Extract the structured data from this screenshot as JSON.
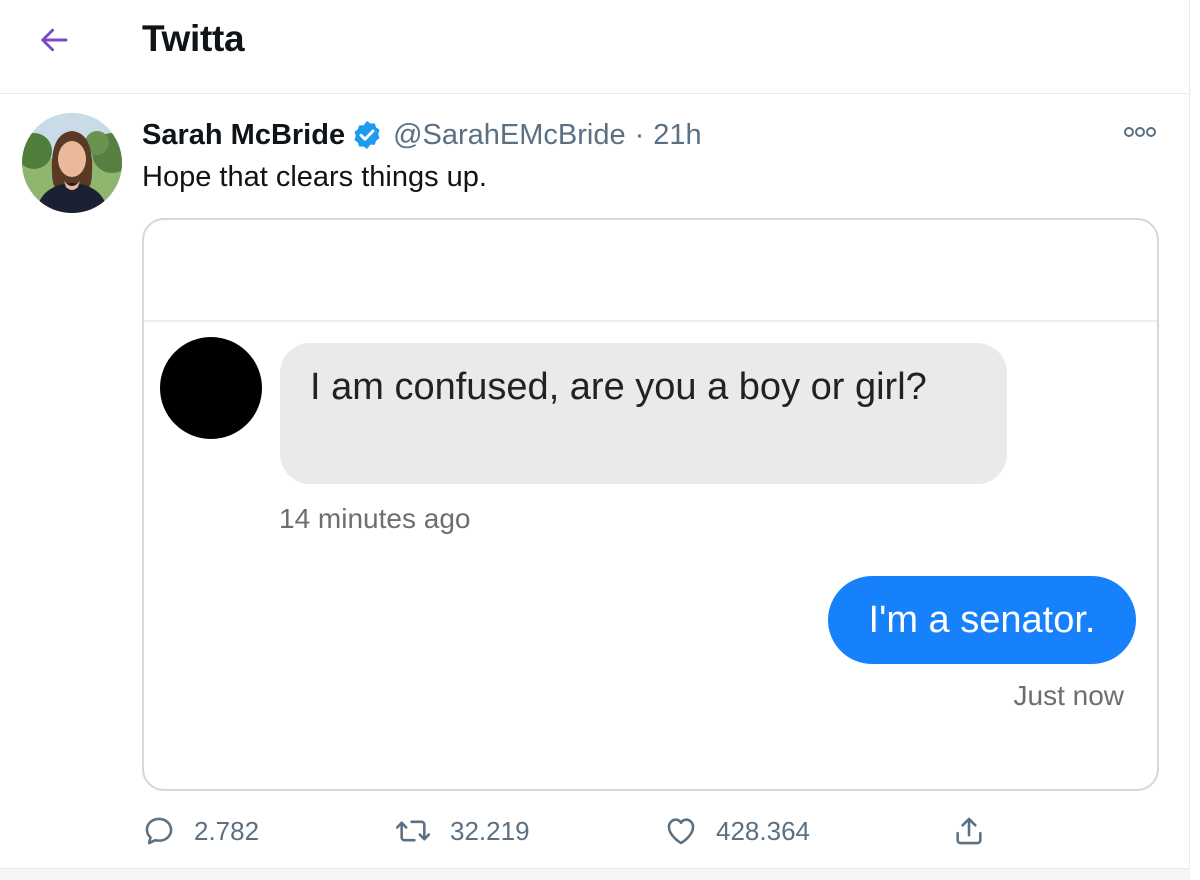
{
  "header": {
    "title": "Twitta",
    "back_icon": "arrow-left-icon",
    "accent_color": "#794bc4"
  },
  "tweet": {
    "author_name": "Sarah McBride",
    "verified_icon": "verified-badge-icon",
    "handle": "@SarahEMcBride",
    "separator": "·",
    "time": "21h",
    "more_icon": "more-horizontal-icon",
    "text": "Hope that clears things up.",
    "media": {
      "incoming_message": "I am confused, are you a boy or girl?",
      "incoming_time": "14 minutes ago",
      "outgoing_message": "I'm a senator.",
      "outgoing_time": "Just now",
      "outgoing_bubble_color": "#1781fb"
    },
    "actions": {
      "reply_count": "2.782",
      "retweet_count": "32.219",
      "like_count": "428.364",
      "reply_icon": "reply-icon",
      "retweet_icon": "retweet-icon",
      "like_icon": "heart-icon",
      "share_icon": "share-icon"
    }
  }
}
